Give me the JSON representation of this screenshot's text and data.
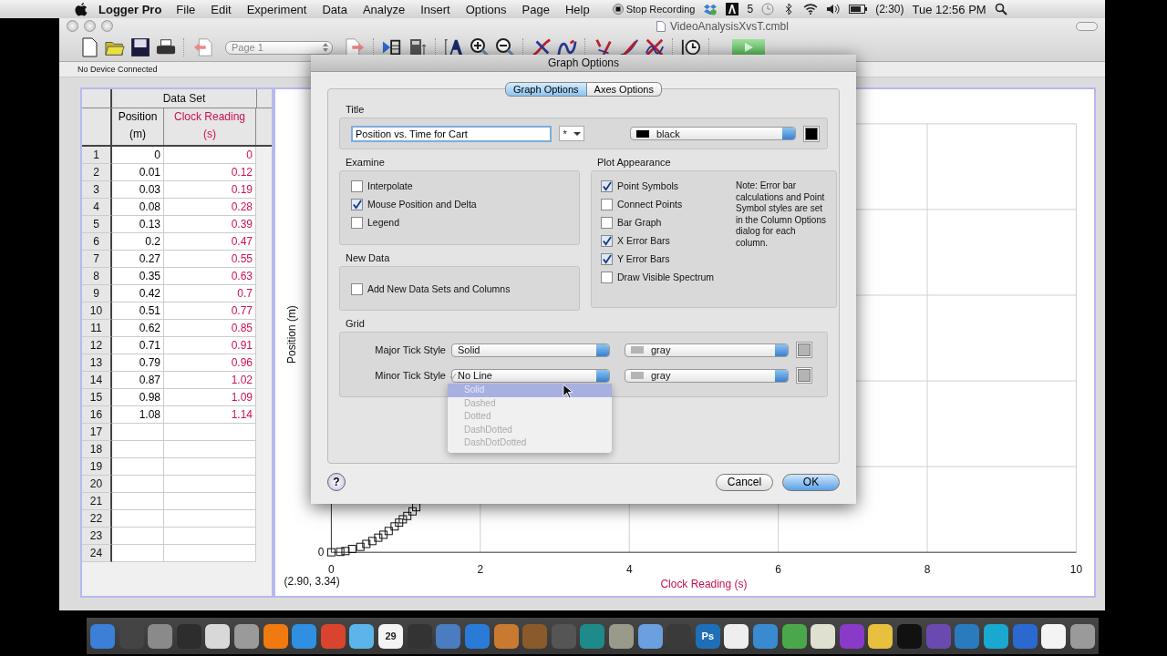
{
  "menu_bar": {
    "app": "Logger Pro",
    "menus": [
      "File",
      "Edit",
      "Experiment",
      "Data",
      "Analyze",
      "Insert",
      "Options",
      "Page",
      "Help"
    ],
    "recording": "Stop Recording",
    "adobe_count": "5",
    "battery_time": "(2:30)",
    "clock": "Tue 12:56 PM"
  },
  "window": {
    "title": "VideoAnalysisXvsT.cmbl",
    "page_select": "Page 1",
    "status": "No Device Connected"
  },
  "table": {
    "title": "Data Set",
    "columns": [
      {
        "name": "Position",
        "unit": "(m)",
        "color": "#000000"
      },
      {
        "name": "Clock Reading",
        "unit": "(s)",
        "color": "#d0104c"
      }
    ],
    "rows": [
      {
        "n": "1",
        "cells": [
          "0",
          "0"
        ]
      },
      {
        "n": "2",
        "cells": [
          "0.01",
          "0.12"
        ]
      },
      {
        "n": "3",
        "cells": [
          "0.03",
          "0.19"
        ]
      },
      {
        "n": "4",
        "cells": [
          "0.08",
          "0.28"
        ]
      },
      {
        "n": "5",
        "cells": [
          "0.13",
          "0.39"
        ]
      },
      {
        "n": "6",
        "cells": [
          "0.2",
          "0.47"
        ]
      },
      {
        "n": "7",
        "cells": [
          "0.27",
          "0.55"
        ]
      },
      {
        "n": "8",
        "cells": [
          "0.35",
          "0.63"
        ]
      },
      {
        "n": "9",
        "cells": [
          "0.42",
          "0.7"
        ]
      },
      {
        "n": "10",
        "cells": [
          "0.51",
          "0.77"
        ]
      },
      {
        "n": "11",
        "cells": [
          "0.62",
          "0.85"
        ]
      },
      {
        "n": "12",
        "cells": [
          "0.71",
          "0.91"
        ]
      },
      {
        "n": "13",
        "cells": [
          "0.79",
          "0.96"
        ]
      },
      {
        "n": "14",
        "cells": [
          "0.87",
          "1.02"
        ]
      },
      {
        "n": "15",
        "cells": [
          "0.98",
          "1.09"
        ]
      },
      {
        "n": "16",
        "cells": [
          "1.08",
          "1.14"
        ]
      },
      {
        "n": "17"
      },
      {
        "n": "18"
      },
      {
        "n": "19"
      },
      {
        "n": "20"
      },
      {
        "n": "21"
      },
      {
        "n": "22"
      },
      {
        "n": "23"
      },
      {
        "n": "24"
      }
    ]
  },
  "graph": {
    "y_label": "Position (m)",
    "y_tick": "0",
    "x_ticks": [
      "0",
      "2",
      "4",
      "6",
      "8",
      "10"
    ],
    "x_label": "Clock Reading (s)",
    "readout": "(2.90, 3.34)"
  },
  "dialog": {
    "title": "Graph Options",
    "tabs": [
      {
        "label": "Graph Options",
        "selected": true
      },
      {
        "label": "Axes Options",
        "selected": false
      }
    ],
    "title_section": {
      "heading": "Title",
      "value": "Position vs. Time for Cart",
      "font_button": "*",
      "color_name": "black",
      "color": "#000000"
    },
    "examine": {
      "heading": "Examine",
      "options": [
        {
          "label": "Interpolate",
          "checked": false
        },
        {
          "label": "Mouse Position and Delta",
          "checked": true
        },
        {
          "label": "Legend",
          "checked": false
        }
      ]
    },
    "new_data": {
      "heading": "New Data",
      "options": [
        {
          "label": "Add New Data Sets and Columns",
          "checked": false
        }
      ]
    },
    "plot_appearance": {
      "heading": "Plot Appearance",
      "options": [
        {
          "label": "Point Symbols",
          "checked": true
        },
        {
          "label": "Connect Points",
          "checked": false
        },
        {
          "label": "Bar Graph",
          "checked": false
        },
        {
          "label": "X Error Bars",
          "checked": true
        },
        {
          "label": "Y Error Bars",
          "checked": true
        },
        {
          "label": "Draw Visible Spectrum",
          "checked": false
        }
      ],
      "note": "Note: Error bar calculations and Point Symbol styles are set in the Column Options dialog for each column."
    },
    "grid": {
      "heading": "Grid",
      "rows": [
        {
          "label": "Major Tick Style",
          "style": "Solid",
          "color_name": "gray",
          "color": "#b4b4b4"
        },
        {
          "label": "Minor Tick Style",
          "style": "No Line",
          "color_name": "gray",
          "color": "#b4b4b4"
        }
      ],
      "menu": [
        {
          "label": "Solid",
          "selected": true
        },
        {
          "label": "Dashed",
          "selected": false
        },
        {
          "label": "Dotted",
          "selected": false
        },
        {
          "label": "DashDotted",
          "selected": false
        },
        {
          "label": "DashDotDotted",
          "selected": false
        }
      ]
    },
    "help": "?",
    "buttons": [
      {
        "label": "Cancel",
        "default": false
      },
      {
        "label": "OK",
        "default": true
      }
    ]
  },
  "dock": [
    {
      "color": "#3b7fd6"
    },
    {
      "color": "#444444"
    },
    {
      "color": "#8a8a8a"
    },
    {
      "color": "#2d2d2d"
    },
    {
      "color": "#d8d8d8"
    },
    {
      "color": "#9a9a9a"
    },
    {
      "color": "#f07a10"
    },
    {
      "color": "#2f8fe0"
    },
    {
      "color": "#d9442e"
    },
    {
      "color": "#5bb5ea"
    },
    {
      "color": "#f4f4f4",
      "label": "29"
    },
    {
      "color": "#333333"
    },
    {
      "color": "#4a7cc0"
    },
    {
      "color": "#2a7ad8"
    },
    {
      "color": "#c87a30"
    },
    {
      "color": "#8a5a2a"
    },
    {
      "color": "#555555"
    },
    {
      "color": "#1f8a8a"
    },
    {
      "color": "#9a9a8a"
    },
    {
      "color": "#6aa0e0"
    },
    {
      "color": "#3a3a3a"
    },
    {
      "color": "#1f6fb8",
      "label": "Ps"
    },
    {
      "color": "#eeeeee"
    },
    {
      "color": "#3a8ad0"
    },
    {
      "color": "#4aa84a"
    },
    {
      "color": "#e0e0d0"
    },
    {
      "color": "#8a3ac8"
    },
    {
      "color": "#e8c040"
    },
    {
      "color": "#111111"
    },
    {
      "color": "#6a4ab0"
    },
    {
      "color": "#2a7ac0"
    },
    {
      "color": "#18a8d0"
    },
    {
      "color": "#2a6ad0"
    },
    {
      "color": "#f4f4f4"
    },
    {
      "color": "#9a9a9a"
    }
  ]
}
